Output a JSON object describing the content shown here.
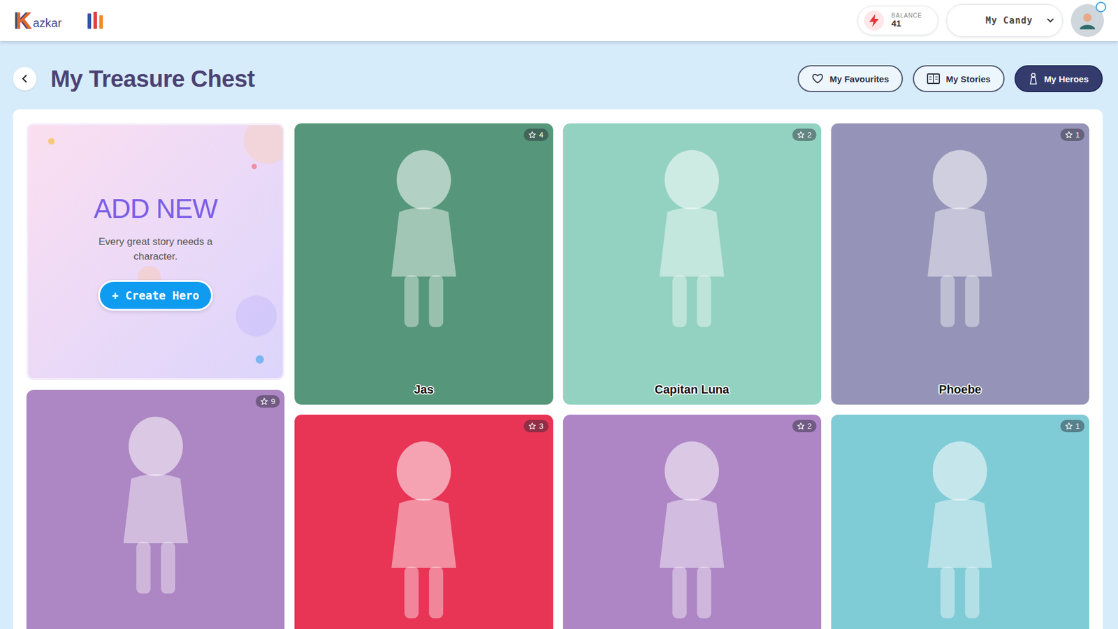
{
  "header": {
    "logo": {
      "initial": "K",
      "rest": "azkar"
    },
    "balance": {
      "label": "BALANCE",
      "value": "41"
    },
    "profile": {
      "label": "My Candy"
    }
  },
  "page": {
    "title": "My Treasure Chest"
  },
  "nav_buttons": [
    {
      "label": "My Favourites",
      "selected": false
    },
    {
      "label": "My Stories",
      "selected": false
    },
    {
      "label": "My Heroes",
      "selected": true
    }
  ],
  "add_card": {
    "title": "ADD NEW",
    "text": "Every great story needs a character.",
    "button": "+ Create Hero"
  },
  "heroes": [
    {
      "name": "Jas",
      "rating": "4",
      "color": "#56977b"
    },
    {
      "name": "Capitan Luna",
      "rating": "2",
      "color": "#93d2c1"
    },
    {
      "name": "Phoebe",
      "rating": "1",
      "color": "#9594b8"
    },
    {
      "rating": "9",
      "color": "#ad86c4"
    },
    {
      "rating": "3",
      "color": "#e83455"
    },
    {
      "rating": "2",
      "color": "#ae86c6"
    },
    {
      "rating": "1",
      "color": "#7fcbd6"
    }
  ]
}
